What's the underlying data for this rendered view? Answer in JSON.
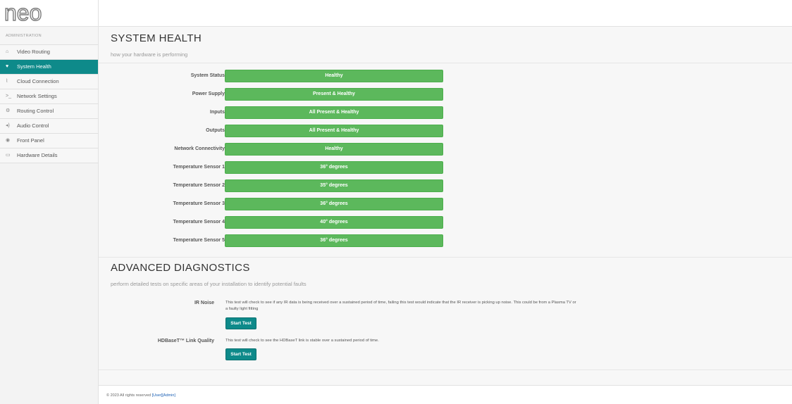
{
  "brand": {
    "logo_text": "neo"
  },
  "sidebar": {
    "section_label": "ADMINISTRATION",
    "items": [
      {
        "label": "Video Routing",
        "icon": "house-icon",
        "glyph": "⌂",
        "active": false
      },
      {
        "label": "System Health",
        "icon": "heart-icon",
        "glyph": "♥",
        "active": true
      },
      {
        "label": "Cloud Connection",
        "icon": "rss-icon",
        "glyph": "⌇",
        "active": false
      },
      {
        "label": "Network Settings",
        "icon": "terminal-icon",
        "glyph": ">_",
        "active": false
      },
      {
        "label": "Routing Control",
        "icon": "gears-icon",
        "glyph": "⚙",
        "active": false
      },
      {
        "label": "Audio Control",
        "icon": "volume-icon",
        "glyph": "◂)",
        "active": false
      },
      {
        "label": "Front Panel",
        "icon": "target-icon",
        "glyph": "◉",
        "active": false
      },
      {
        "label": "Hardware Details",
        "icon": "hdd-icon",
        "glyph": "▭",
        "active": false
      }
    ]
  },
  "system_health": {
    "title": "SYSTEM HEALTH",
    "subtitle": "how your hardware is performing",
    "rows": [
      {
        "label": "System Status",
        "value": "Healthy"
      },
      {
        "label": "Power Supply",
        "value": "Present & Healthy"
      },
      {
        "label": "Inputs",
        "value": "All Present & Healthy"
      },
      {
        "label": "Outputs",
        "value": "All Present & Healthy"
      },
      {
        "label": "Network Connectivity",
        "value": "Healthy"
      },
      {
        "label": "Temperature Sensor 1",
        "value": "36° degrees"
      },
      {
        "label": "Temperature Sensor 2",
        "value": "35° degrees"
      },
      {
        "label": "Temperature Sensor 3",
        "value": "36° degrees"
      },
      {
        "label": "Temperature Sensor 4",
        "value": "40° degrees"
      },
      {
        "label": "Temperature Sensor 5",
        "value": "36° degrees"
      }
    ],
    "status_color": "#5cb85c"
  },
  "advanced_diagnostics": {
    "title": "ADVANCED DIAGNOSTICS",
    "subtitle": "perform detailed tests on specific areas of your installation to identify potential faults",
    "tests": [
      {
        "label": "IR Noise",
        "description": "This test will check to see if any IR data is being received over a sustained period of time, failing this test would indicate that the IR receiver is picking up noise. This could be from a Plasma TV or a faulty light fitting",
        "button": "Start Test"
      },
      {
        "label": "HDBaseT™ Link Quality",
        "description": "This test will check to see the HDBaseT link is stable over a sustained period of time.",
        "button": "Start Test"
      }
    ]
  },
  "footer": {
    "copyright": "© 2023 All rights reserved",
    "user_link": "[User]",
    "admin_link": "[Admin]"
  },
  "colors": {
    "accent": "#0e8a8a",
    "healthy": "#5cb85c"
  }
}
